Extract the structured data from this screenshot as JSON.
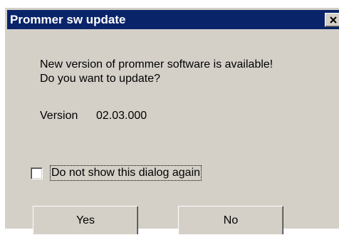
{
  "window": {
    "title": "Prommer sw update",
    "close_icon": "close-icon"
  },
  "message": {
    "line1": "New version of prommer software is available!",
    "line2": "Do you want to update?"
  },
  "version": {
    "label": "Version",
    "value": "02.03.000"
  },
  "checkbox": {
    "label": "Do not show this dialog again",
    "checked": false
  },
  "buttons": {
    "yes": "Yes",
    "no": "No"
  },
  "colors": {
    "titlebar": "#0a246a",
    "face": "#d4d0c8"
  }
}
